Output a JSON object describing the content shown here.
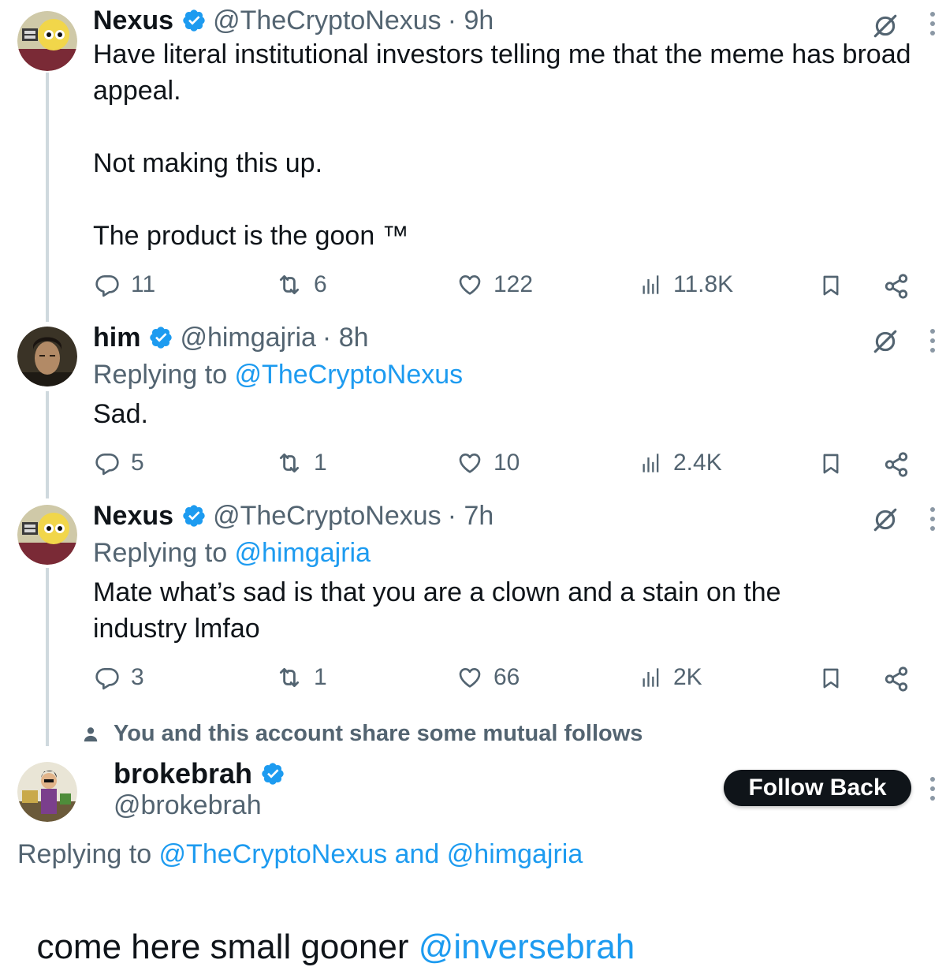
{
  "tweets": [
    {
      "name": "Nexus",
      "handle": "@TheCryptoNexus",
      "time": "· 9h",
      "body": "Have literal institutional investors telling me that the meme has broad appeal.\n\nNot making this up.\n\nThe product is the goon ™",
      "replies": "11",
      "reposts": "6",
      "likes": "122",
      "views": "11.8K"
    },
    {
      "name": "him",
      "handle": "@himgajria",
      "time": "· 8h",
      "replying_prefix": "Replying to ",
      "replying_to": "@TheCryptoNexus",
      "body": "Sad.",
      "replies": "5",
      "reposts": "1",
      "likes": "10",
      "views": "2.4K"
    },
    {
      "name": "Nexus",
      "handle": "@TheCryptoNexus",
      "time": "· 7h",
      "replying_prefix": "Replying to ",
      "replying_to": "@himgajria",
      "body": "Mate what’s sad is that you are a clown and a stain on the industry lmfao",
      "replies": "3",
      "reposts": "1",
      "likes": "66",
      "views": "2K"
    }
  ],
  "mutual_notice": "You and this account share some mutual follows",
  "focus_tweet": {
    "name": "brokebrah",
    "handle": "@brokebrah",
    "follow_label": "Follow Back",
    "replying_prefix": "Replying to ",
    "replying_to_1": "@TheCryptoNexus",
    "replying_joiner": " and ",
    "replying_to_2": "@himgajria",
    "body_text": "come here small gooner ",
    "body_mention": "@inversebrah"
  },
  "colors": {
    "accent": "#1d9bf0",
    "secondary_text": "#536471",
    "primary_text": "#0f1419",
    "thread_line": "#cfd9de"
  },
  "icons": [
    "verified-badge-icon",
    "grok-icon",
    "more-icon",
    "reply-icon",
    "repost-icon",
    "like-icon",
    "views-icon",
    "bookmark-icon",
    "share-icon",
    "person-icon"
  ]
}
